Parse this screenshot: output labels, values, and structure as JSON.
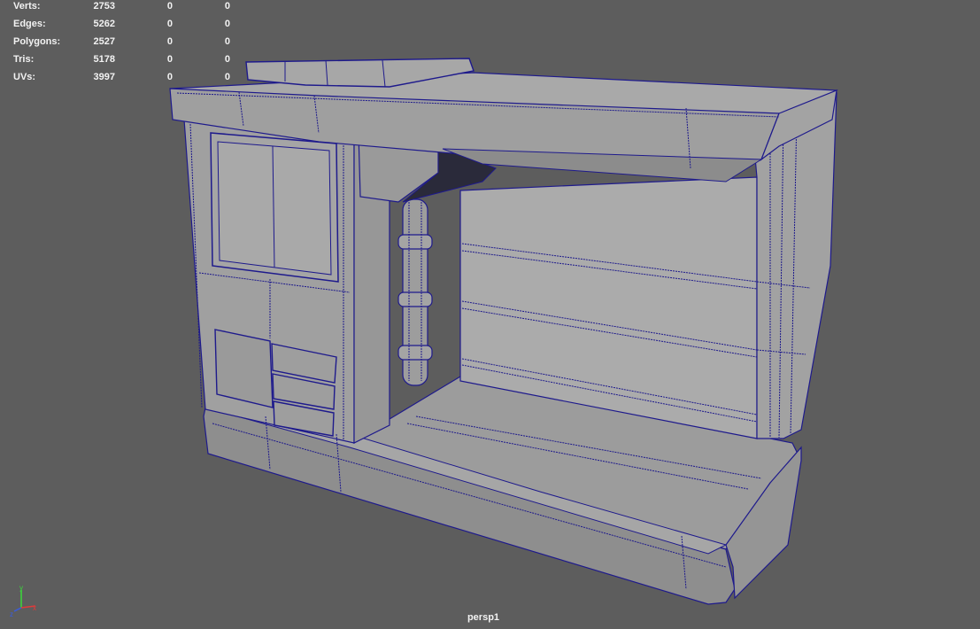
{
  "hud": {
    "rows": [
      {
        "label": "Verts:",
        "v1": "2753",
        "v2": "0",
        "v3": "0"
      },
      {
        "label": "Edges:",
        "v1": "5262",
        "v2": "0",
        "v3": "0"
      },
      {
        "label": "Polygons:",
        "v1": "2527",
        "v2": "0",
        "v3": "0"
      },
      {
        "label": "Tris:",
        "v1": "5178",
        "v2": "0",
        "v3": "0"
      },
      {
        "label": "UVs:",
        "v1": "3997",
        "v2": "0",
        "v3": "0"
      }
    ]
  },
  "camera": {
    "name": "persp1"
  },
  "axis": {
    "y": "y",
    "x": "x",
    "z": "z"
  },
  "colors": {
    "background": "#5d5d5d",
    "wire": "#1e1a8c",
    "surface": "#a8a8a8",
    "axis_x": "#e03a3a",
    "axis_y": "#3adb3a",
    "axis_z": "#3a5ce0"
  }
}
